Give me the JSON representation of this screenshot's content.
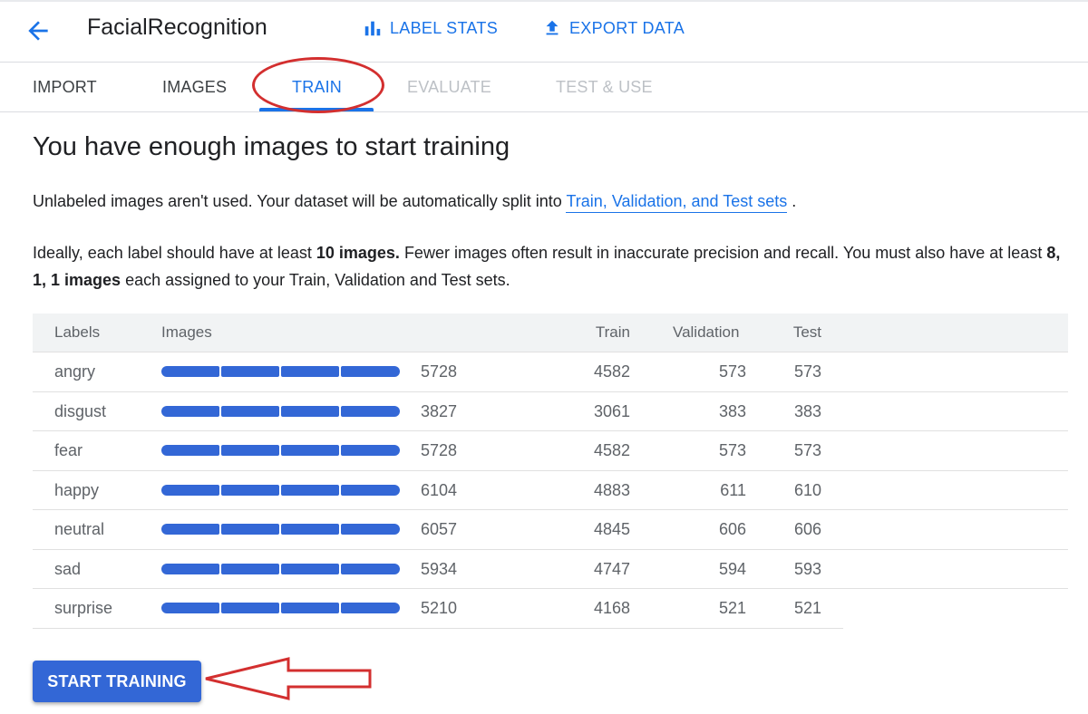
{
  "header": {
    "title": "FacialRecognition",
    "label_stats": "LABEL STATS",
    "export_data": "EXPORT DATA"
  },
  "tabs": [
    {
      "label": "IMPORT",
      "state": "enabled"
    },
    {
      "label": "IMAGES",
      "state": "enabled"
    },
    {
      "label": "TRAIN",
      "state": "active"
    },
    {
      "label": "EVALUATE",
      "state": "disabled"
    },
    {
      "label": "TEST & USE",
      "state": "disabled"
    }
  ],
  "main": {
    "heading": "You have enough images to start training",
    "para1_text": "Unlabeled images aren't used. Your dataset will be automatically split into ",
    "para1_link": "Train, Validation, and Test sets",
    "para1_end": " .",
    "para2_a": "Ideally, each label should have at least ",
    "para2_b": "10 images.",
    "para2_c": " Fewer images often result in inaccurate precision and recall. You must also have at least ",
    "para2_d": "8, 1, 1 images",
    "para2_e": " each assigned to your Train, Validation and Test sets."
  },
  "table": {
    "headers": {
      "labels": "Labels",
      "images": "Images",
      "train": "Train",
      "validation": "Validation",
      "test": "Test"
    },
    "rows": [
      {
        "label": "angry",
        "images": "5728",
        "train": "4582",
        "validation": "573",
        "test": "573"
      },
      {
        "label": "disgust",
        "images": "3827",
        "train": "3061",
        "validation": "383",
        "test": "383"
      },
      {
        "label": "fear",
        "images": "5728",
        "train": "4582",
        "validation": "573",
        "test": "573"
      },
      {
        "label": "happy",
        "images": "6104",
        "train": "4883",
        "validation": "611",
        "test": "610"
      },
      {
        "label": "neutral",
        "images": "6057",
        "train": "4845",
        "validation": "606",
        "test": "606"
      },
      {
        "label": "sad",
        "images": "5934",
        "train": "4747",
        "validation": "594",
        "test": "593"
      },
      {
        "label": "surprise",
        "images": "5210",
        "train": "4168",
        "validation": "521",
        "test": "521"
      }
    ]
  },
  "start_button": "START TRAINING",
  "colors": {
    "accent": "#1a73e8",
    "bar": "#3367d6",
    "annotation": "#d32f2f"
  },
  "icons": [
    "back-arrow-icon",
    "bar-chart-icon",
    "upload-icon"
  ]
}
